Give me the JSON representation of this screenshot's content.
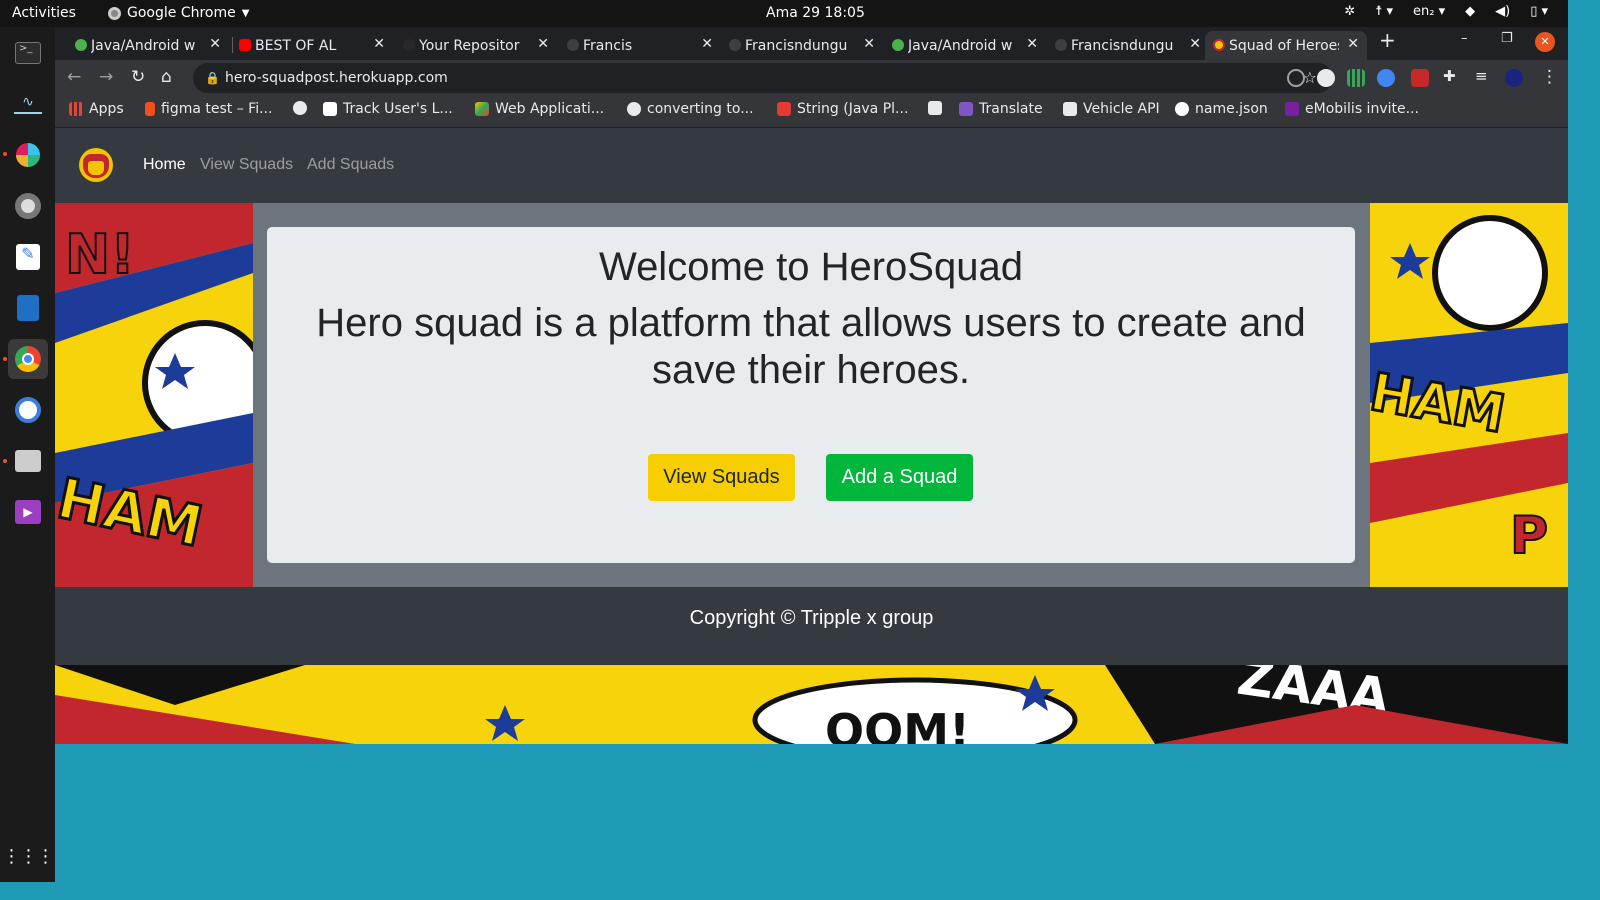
{
  "os": {
    "activities": "Activities",
    "app_name": "Google Chrome",
    "clock": "Ama 29  18:05",
    "lang": "en₂"
  },
  "tabs": [
    {
      "title": "Java/Android w",
      "fav": "#4caf50"
    },
    {
      "title": "BEST OF AL",
      "fav": "#ff0000"
    },
    {
      "title": "Your Repositor",
      "fav": "#24292e"
    },
    {
      "title": "Francis",
      "fav": "#9aa0a6"
    },
    {
      "title": "Francisndungu",
      "fav": "#24292e"
    },
    {
      "title": "Java/Android w",
      "fav": "#4caf50"
    },
    {
      "title": "Francisndungu",
      "fav": "#24292e"
    },
    {
      "title": "Squad of Heroes",
      "fav": "#f2c500"
    }
  ],
  "url": "hero-squadpost.herokuapp.com",
  "bookmarks": [
    {
      "label": "Apps",
      "color": "#ea4335"
    },
    {
      "label": "figma test – Fi...",
      "color": "#f24e1e"
    },
    {
      "label": "",
      "color": "#e8eaed"
    },
    {
      "label": "Track User's L...",
      "color": "#ffffff"
    },
    {
      "label": "Web Applicati...",
      "color": "#fbbc04"
    },
    {
      "label": "converting to...",
      "color": "#e8eaed"
    },
    {
      "label": "String (Java Pl...",
      "color": "#e53935"
    },
    {
      "label": "",
      "color": "#e8eaed"
    },
    {
      "label": "Translate",
      "color": "#7e57c2"
    },
    {
      "label": "Vehicle API",
      "color": "#e8eaed"
    },
    {
      "label": "name.json",
      "color": "#ffffff"
    },
    {
      "label": "eMobilis invite...",
      "color": "#7b1fa2"
    }
  ],
  "site": {
    "nav": {
      "home": "Home",
      "view_squads": "View Squads",
      "add_squads": "Add Squads"
    },
    "welcome": "Welcome to HeroSquad",
    "tagline": "Hero squad is a platform that allows users to create and save their heroes.",
    "btn_view": "View Squads",
    "btn_add": "Add a Squad",
    "footer": "Copyright © Tripple x group"
  },
  "colors": {
    "navbar": "#343a40",
    "jumbotron": "#e9ecef",
    "yellow_btn": "#f7cf00",
    "green_btn": "#00b63b",
    "page_bg": "#1f9bb7"
  }
}
